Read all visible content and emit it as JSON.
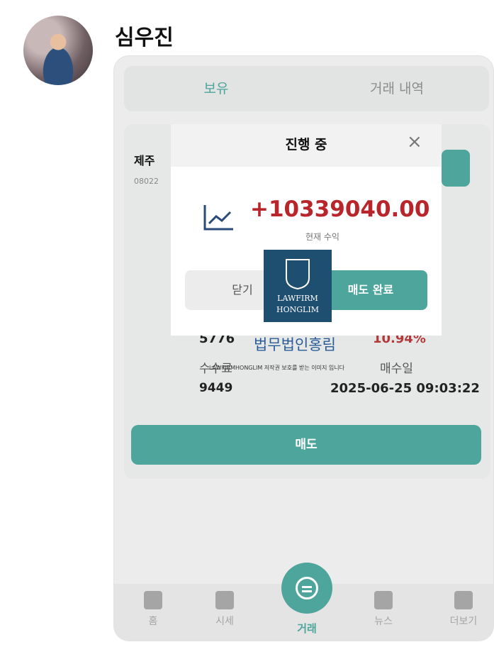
{
  "sender": {
    "name": "심우진"
  },
  "tabs": {
    "holdings": "보유",
    "history": "거래 내역"
  },
  "stock": {
    "name": "제주",
    "code": "08022"
  },
  "details": {
    "value_left": "5776",
    "pct": "10.94%",
    "fee_label": "수수료",
    "sell_date_label": "매수일",
    "fee_value": "9449",
    "sell_date": "2025-06-25 09:03:22"
  },
  "sell_button": "매도",
  "modal": {
    "title": "진행 중",
    "close_icon": "×",
    "profit": "+10339040.00",
    "profit_label": "현재 수익",
    "close_button": "닫기",
    "done_button": "매도 완료"
  },
  "watermark": {
    "logo_line1": "LAWFIRM",
    "logo_line2": "HONGLIM",
    "name": "법무법인홍림",
    "copyright": "LAWFIRMHONGLIM 저작권 보호를 받는 이미지 입니다"
  },
  "nav": {
    "home": "홈",
    "market": "시세",
    "trade": "거래",
    "news": "뉴스",
    "more": "더보기"
  },
  "colors": {
    "accent": "#4ea59c",
    "profit": "#b8262c",
    "watermark": "#1f4f70"
  }
}
